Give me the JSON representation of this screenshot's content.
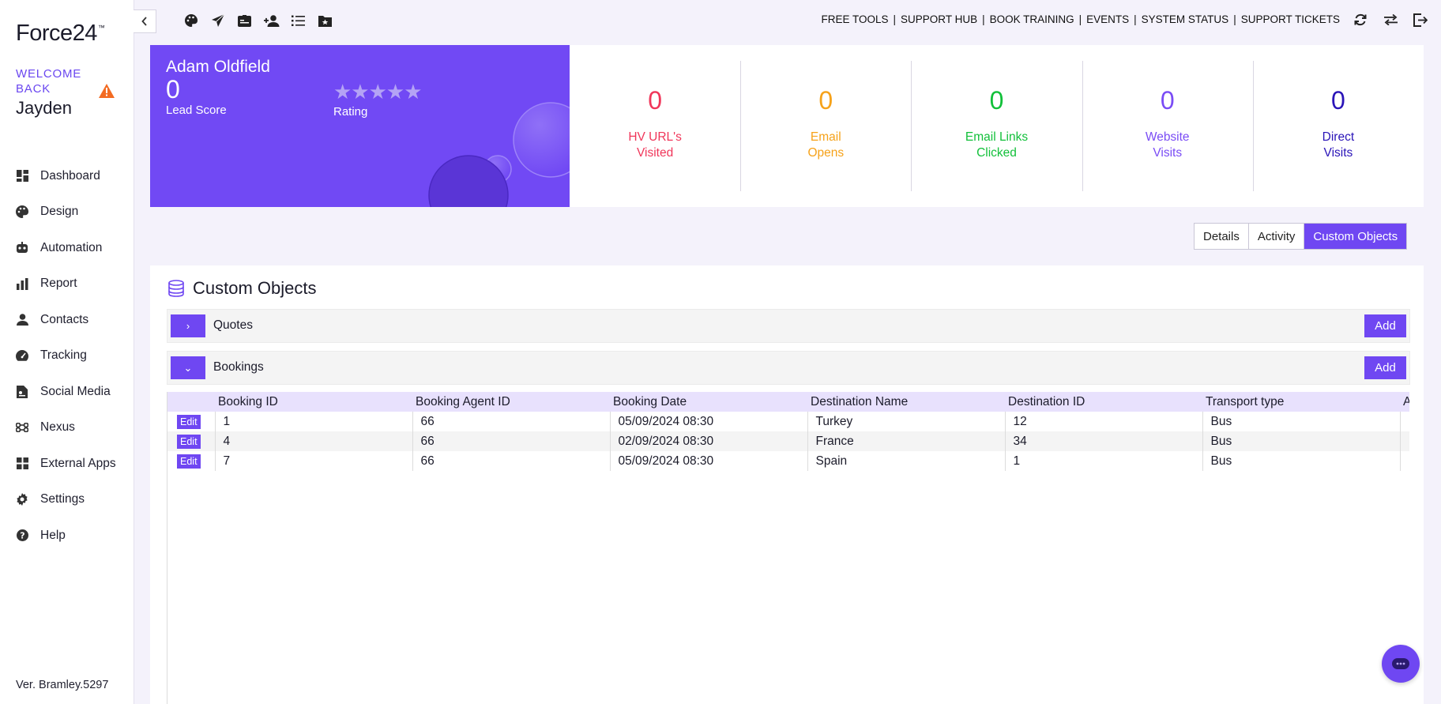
{
  "sidebar": {
    "logo": "Force24",
    "logo_tm": "™",
    "welcome": "WELCOME BACK",
    "user": "Jayden",
    "items": [
      {
        "label": "Dashboard",
        "icon": "dashboard-icon"
      },
      {
        "label": "Design",
        "icon": "palette-icon"
      },
      {
        "label": "Automation",
        "icon": "robot-icon"
      },
      {
        "label": "Report",
        "icon": "bar-chart-icon"
      },
      {
        "label": "Contacts",
        "icon": "person-icon"
      },
      {
        "label": "Tracking",
        "icon": "gauge-icon"
      },
      {
        "label": "Social Media",
        "icon": "social-icon"
      },
      {
        "label": "Nexus",
        "icon": "nexus-icon"
      },
      {
        "label": "External Apps",
        "icon": "apps-grid-icon"
      },
      {
        "label": "Settings",
        "icon": "gear-icon"
      },
      {
        "label": "Help",
        "icon": "help-icon"
      }
    ],
    "version": "Ver. Bramley.5297"
  },
  "topbar": {
    "links": [
      "FREE TOOLS",
      "SUPPORT HUB",
      "BOOK TRAINING",
      "EVENTS",
      "SYSTEM STATUS",
      "SUPPORT TICKETS"
    ],
    "separator": "|"
  },
  "profile": {
    "name": "Adam Oldfield",
    "score": "0",
    "score_label": "Lead Score",
    "stars": "★★★★★",
    "rating_label": "Rating"
  },
  "stats": [
    {
      "value": "0",
      "line1": "HV URL's",
      "line2": "Visited",
      "color": "#f0365a"
    },
    {
      "value": "0",
      "line1": "Email",
      "line2": "Opens",
      "color": "#f6a21a"
    },
    {
      "value": "0",
      "line1": "Email Links",
      "line2": "Clicked",
      "color": "#12c03a"
    },
    {
      "value": "0",
      "line1": "Website",
      "line2": "Visits",
      "color": "#7a4cf5"
    },
    {
      "value": "0",
      "line1": "Direct",
      "line2": "Visits",
      "color": "#2a14b8"
    }
  ],
  "tabs": [
    "Details",
    "Activity",
    "Custom Objects"
  ],
  "panel": {
    "title": "Custom Objects",
    "groups": [
      {
        "name": "Quotes",
        "toggle": "›",
        "add": "Add"
      },
      {
        "name": "Bookings",
        "toggle": "⌄",
        "add": "Add"
      }
    ],
    "table": {
      "edit_label": "Edit",
      "columns": [
        "Booking ID",
        "Booking Agent ID",
        "Booking Date",
        "Destination Name",
        "Destination ID",
        "Transport type",
        "A"
      ],
      "rows": [
        [
          "1",
          "66",
          "05/09/2024 08:30",
          "Turkey",
          "12",
          "Bus",
          ""
        ],
        [
          "4",
          "66",
          "02/09/2024 08:30",
          "France",
          "34",
          "Bus",
          ""
        ],
        [
          "7",
          "66",
          "05/09/2024 08:30",
          "Spain",
          "1",
          "Bus",
          ""
        ]
      ]
    }
  },
  "colors": {
    "accent": "#6f47f2"
  }
}
